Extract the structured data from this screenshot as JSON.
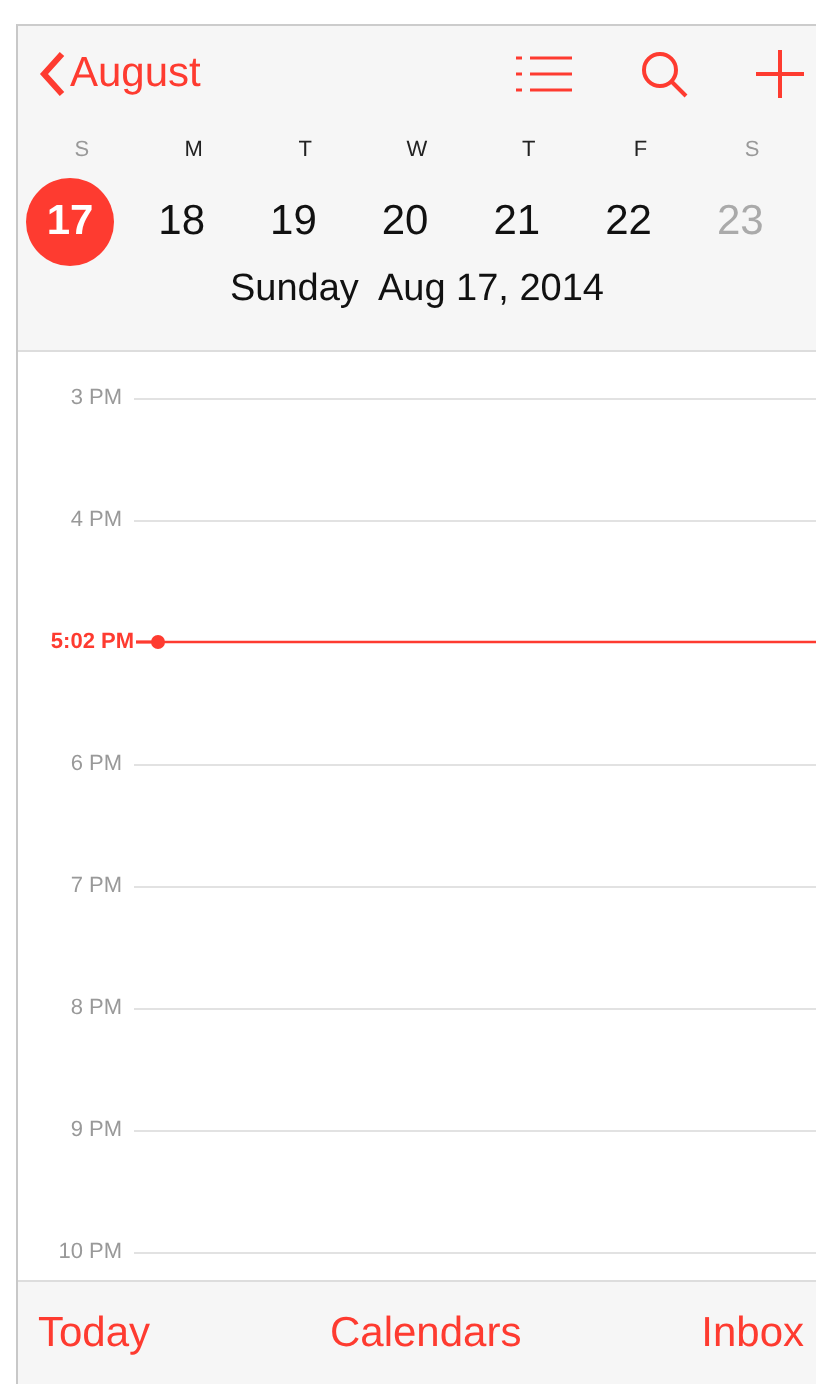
{
  "nav": {
    "back": "August"
  },
  "days": [
    {
      "letter": "S",
      "number": "17",
      "selected": true,
      "weekend": true
    },
    {
      "letter": "M",
      "number": "18",
      "selected": false,
      "weekend": false
    },
    {
      "letter": "T",
      "number": "19",
      "selected": false,
      "weekend": false
    },
    {
      "letter": "W",
      "number": "20",
      "selected": false,
      "weekend": false
    },
    {
      "letter": "T",
      "number": "21",
      "selected": false,
      "weekend": false
    },
    {
      "letter": "F",
      "number": "22",
      "selected": false,
      "weekend": false
    },
    {
      "letter": "S",
      "number": "23",
      "selected": false,
      "weekend": true
    }
  ],
  "date_title": {
    "weekday": "Sunday",
    "date": "Aug 17, 2014"
  },
  "timeline": [
    {
      "kind": "hour",
      "label": "3 PM"
    },
    {
      "kind": "hour",
      "label": "4 PM"
    },
    {
      "kind": "now",
      "label": "5:02 PM"
    },
    {
      "kind": "hour",
      "label": "6 PM"
    },
    {
      "kind": "hour",
      "label": "7 PM"
    },
    {
      "kind": "hour",
      "label": "8 PM"
    },
    {
      "kind": "hour",
      "label": "9 PM"
    },
    {
      "kind": "hour",
      "label": "10 PM"
    }
  ],
  "toolbar": [
    "Today",
    "Calendars",
    "Inbox"
  ]
}
